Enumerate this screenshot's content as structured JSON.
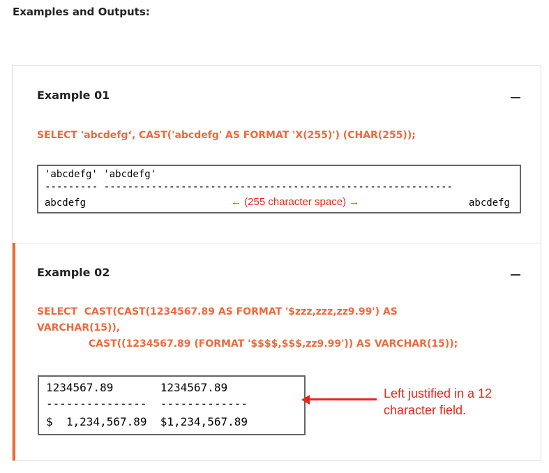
{
  "section_heading": "Examples and Outputs:",
  "example1": {
    "title": "Example 01",
    "toggle": "minus-icon",
    "sql": "SELECT 'abcdefg‘, CAST('abcdefg' AS FORMAT 'X(255)') (CHAR(255));",
    "output": {
      "header_line": "'abcdefg' 'abcdefg'",
      "dash_line": "--------- -----------------------------------------------------------",
      "left_value": "abcdefg",
      "note": "← (255 character space) →",
      "right_value": "abcdefg"
    }
  },
  "example2": {
    "title": "Example 02",
    "toggle": "minus-icon",
    "sql_line1": "SELECT  CAST(CAST(1234567.89 AS FORMAT '$zzz,zzz,zz9.99') AS",
    "sql_line2": "VARCHAR(15)),",
    "sql_line3": "CAST((1234567.89 (FORMAT '$$$$,$$$,zz9.99')) AS VARCHAR(15));",
    "output": {
      "row1": "1234567.89       1234567.89",
      "row2": "---------------  -------------",
      "row3": "$  1,234,567.89  $1,234,567.89"
    },
    "annotation": "Left justified in a 12\ncharacter field."
  },
  "colors": {
    "accent": "#f26b2d",
    "sql_text": "#f0683a",
    "annotation_red": "#e8261d"
  }
}
